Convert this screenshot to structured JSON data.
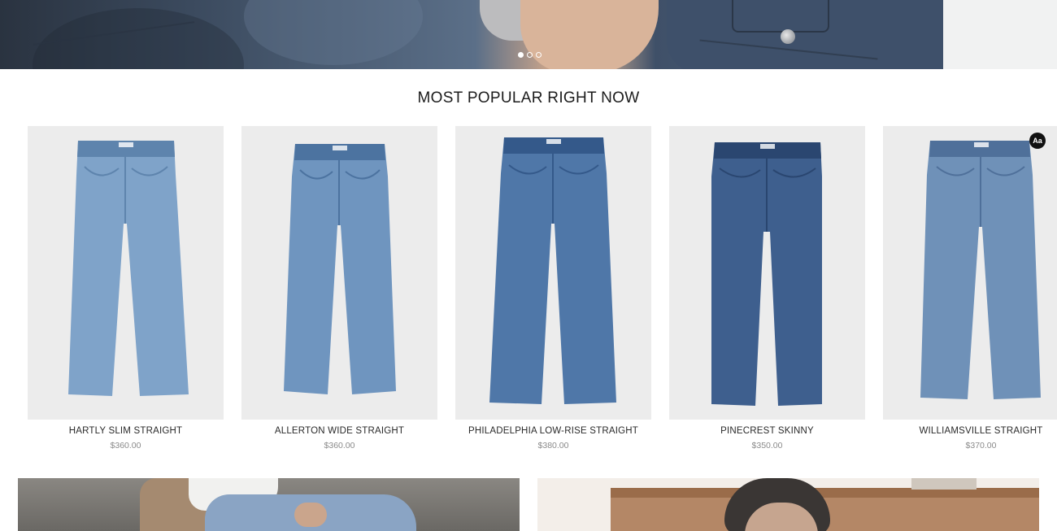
{
  "hero": {
    "slides_count": 3,
    "active_slide": 1
  },
  "section": {
    "title": "MOST POPULAR RIGHT NOW"
  },
  "products": [
    {
      "name": "HARTLY SLIM STRAIGHT",
      "price": "$360.00",
      "wash": "#7fa3c9",
      "wash_dark": "#5e84ad"
    },
    {
      "name": "ALLERTON WIDE STRAIGHT",
      "price": "$360.00",
      "wash": "#6f95bf",
      "wash_dark": "#4c73a0"
    },
    {
      "name": "PHILADELPHIA LOW-RISE STRAIGHT",
      "price": "$380.00",
      "wash": "#4f77a8",
      "wash_dark": "#34598a"
    },
    {
      "name": "PINECREST SKINNY",
      "price": "$350.00",
      "wash": "#3e5f8e",
      "wash_dark": "#2a4670"
    },
    {
      "name": "WILLIAMSVILLE STRAIGHT",
      "price": "$370.00",
      "wash": "#6f91b8",
      "wash_dark": "#4f709a"
    }
  ],
  "accessibility_badge": {
    "label": "Aa"
  }
}
